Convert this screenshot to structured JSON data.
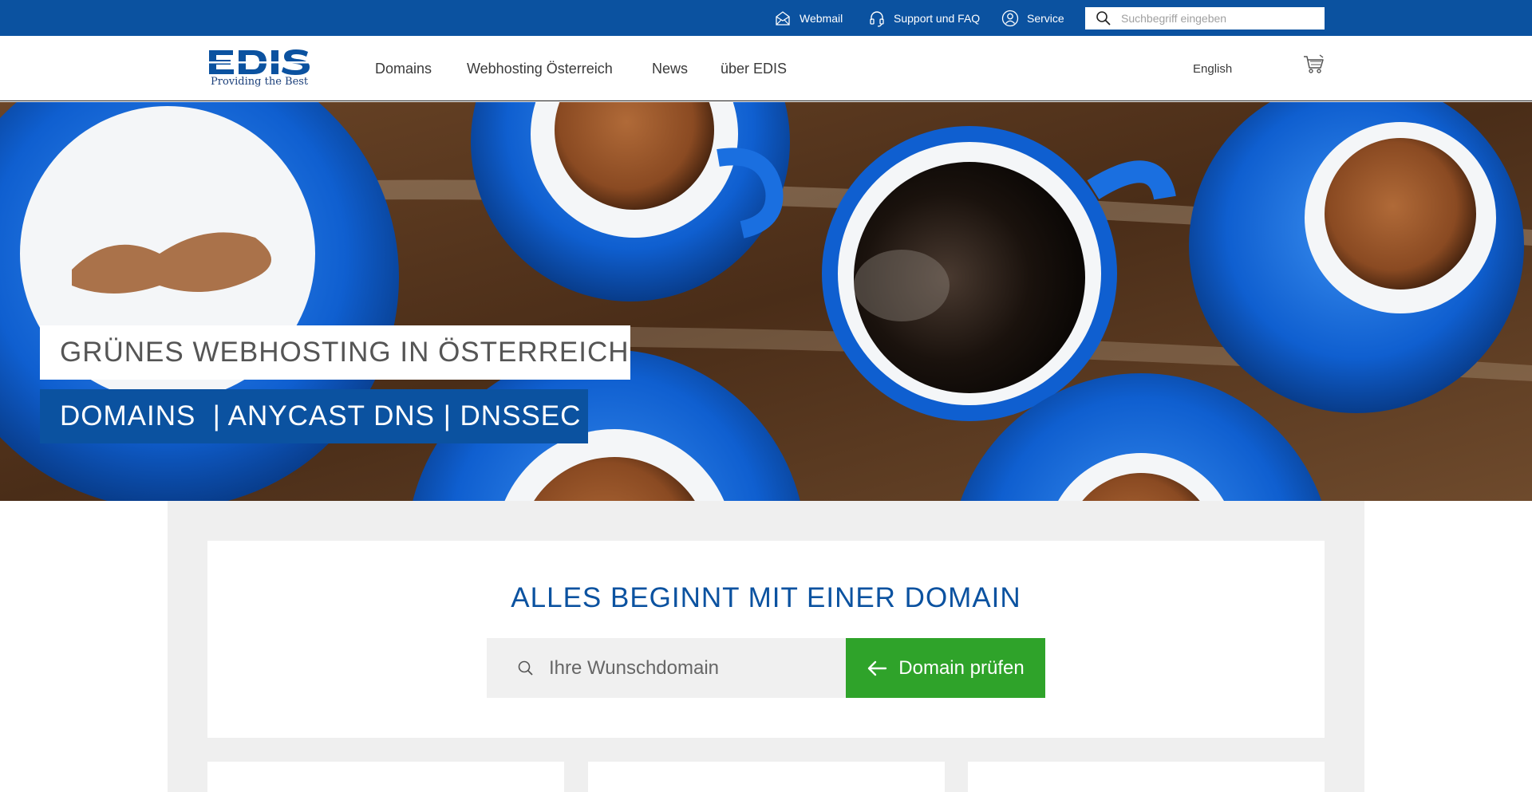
{
  "topbar": {
    "webmail": "Webmail",
    "support": "Support und FAQ",
    "service": "Service",
    "search_placeholder": "Suchbegriff eingeben"
  },
  "nav": {
    "logo_text": "EDIS",
    "logo_tagline": "Providing the Best",
    "items": [
      "Domains",
      "Webhosting Österreich",
      "News",
      "über EDIS"
    ],
    "language": "English"
  },
  "hero": {
    "headline": "GRÜNES WEBHOSTING IN ÖSTERREICH",
    "subline": "DOMAINS  | ANYCAST DNS | DNSSEC"
  },
  "domain_search": {
    "title": "ALLES BEGINNT MIT EINER DOMAIN",
    "placeholder": "Ihre Wunschdomain",
    "button_label": "Domain prüfen"
  },
  "colors": {
    "brand_blue": "#0b52a0",
    "cta_green": "#2fa32a",
    "panel_gray": "#efefef"
  },
  "icons": [
    "mail-icon",
    "headset-icon",
    "user-icon",
    "search-icon",
    "cart-icon",
    "arrow-left-icon"
  ]
}
